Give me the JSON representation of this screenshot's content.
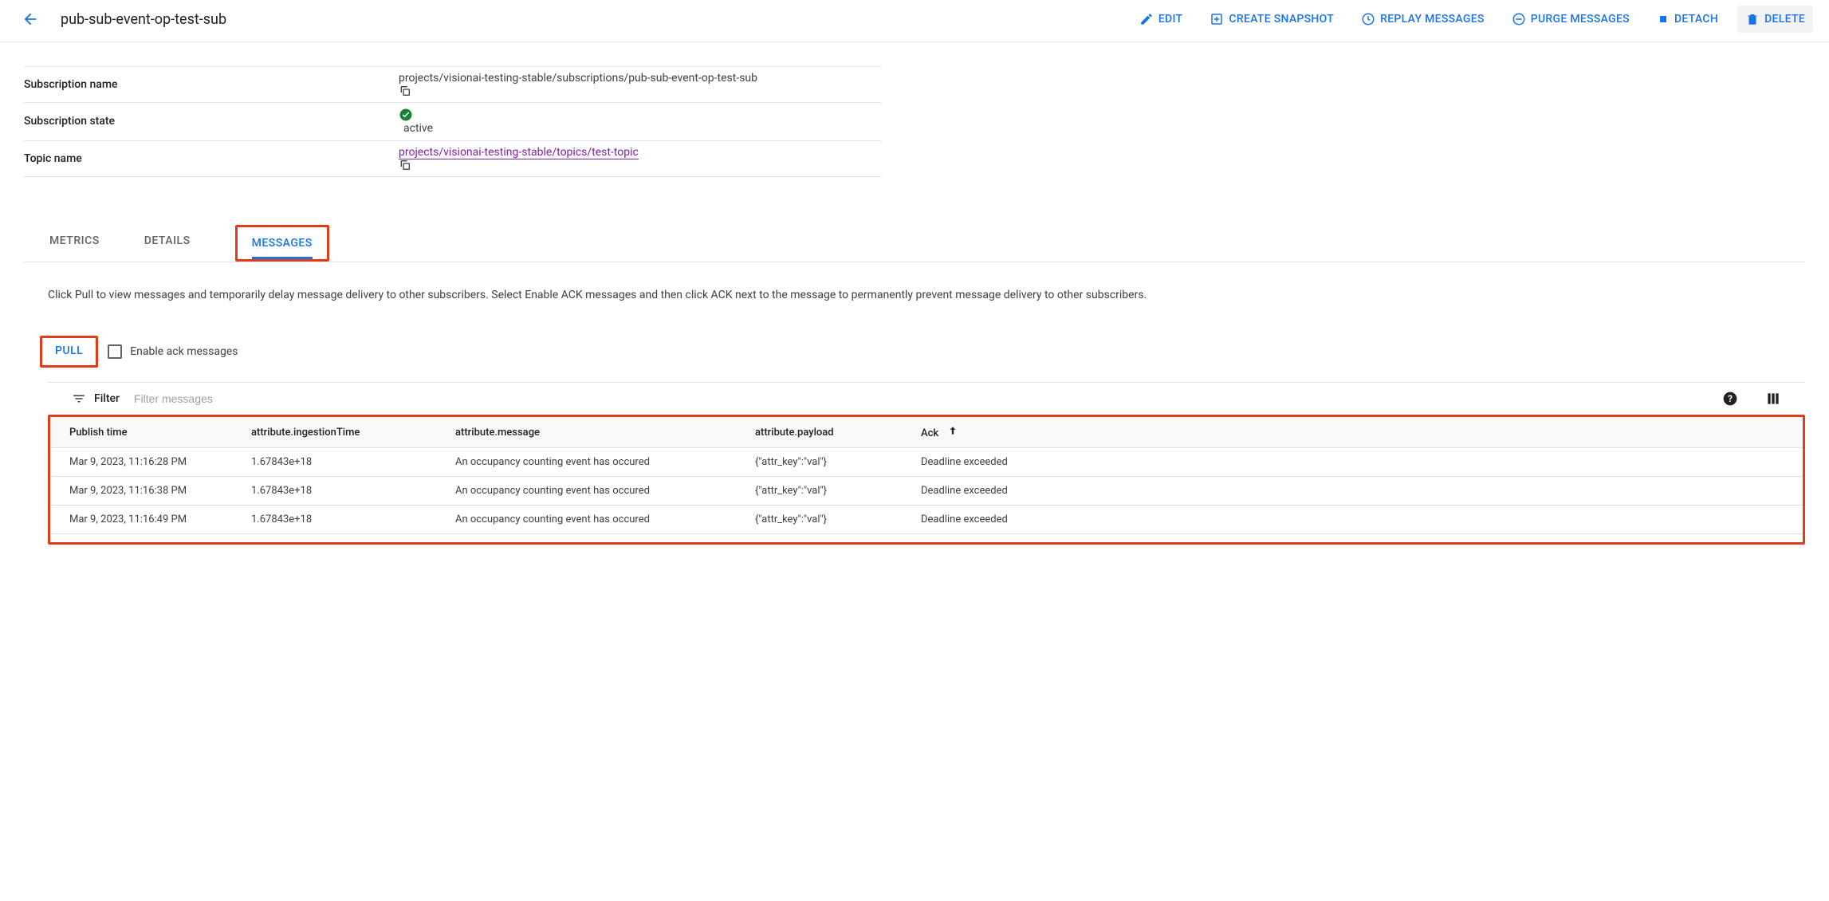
{
  "header": {
    "title": "pub-sub-event-op-test-sub",
    "actions": {
      "edit": "EDIT",
      "snapshot": "CREATE SNAPSHOT",
      "replay": "REPLAY MESSAGES",
      "purge": "PURGE MESSAGES",
      "detach": "DETACH",
      "delete": "DELETE"
    }
  },
  "details": {
    "subscription_name_label": "Subscription name",
    "subscription_name_value": "projects/visionai-testing-stable/subscriptions/pub-sub-event-op-test-sub",
    "subscription_state_label": "Subscription state",
    "subscription_state_value": "active",
    "topic_name_label": "Topic name",
    "topic_name_value": "projects/visionai-testing-stable/topics/test-topic"
  },
  "tabs": {
    "metrics": "METRICS",
    "details": "DETAILS",
    "messages": "MESSAGES"
  },
  "messages": {
    "help_text": "Click Pull to view messages and temporarily delay message delivery to other subscribers. Select Enable ACK messages and then click ACK next to the message to permanently prevent message delivery to other subscribers.",
    "pull_label": "PULL",
    "ack_checkbox_label": "Enable ack messages",
    "filter_label": "Filter",
    "filter_placeholder": "Filter messages",
    "columns": {
      "publish_time": "Publish time",
      "ingestion_time": "attribute.ingestionTime",
      "message": "attribute.message",
      "payload": "attribute.payload",
      "ack": "Ack"
    },
    "rows": [
      {
        "publish_time": "Mar 9, 2023, 11:16:28 PM",
        "ingestion_time": "1.67843e+18",
        "message": "An occupancy counting event has occured",
        "payload": "{\"attr_key\":\"val\"}",
        "ack": "Deadline exceeded"
      },
      {
        "publish_time": "Mar 9, 2023, 11:16:38 PM",
        "ingestion_time": "1.67843e+18",
        "message": "An occupancy counting event has occured",
        "payload": "{\"attr_key\":\"val\"}",
        "ack": "Deadline exceeded"
      },
      {
        "publish_time": "Mar 9, 2023, 11:16:49 PM",
        "ingestion_time": "1.67843e+18",
        "message": "An occupancy counting event has occured",
        "payload": "{\"attr_key\":\"val\"}",
        "ack": "Deadline exceeded"
      }
    ]
  }
}
